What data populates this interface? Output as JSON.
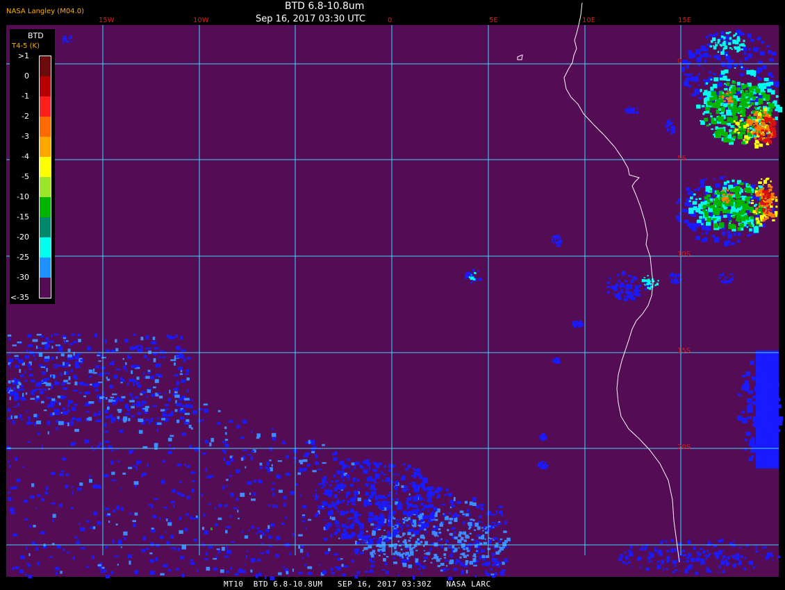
{
  "header": {
    "org_label": "NASA Langley (M04.0)",
    "title": "BTD 6.8-10.8um",
    "datetime": "Sep 16, 2017 03:30 UTC"
  },
  "footer": {
    "text": "MT10  BTD 6.8-10.8UM   SEP 16, 2017 03:30Z   NASA LARC"
  },
  "grid": {
    "longitude_labels": [
      "15W",
      "10W",
      "0",
      "5E",
      "10E",
      "15E"
    ],
    "latitude_labels": [
      "0",
      "5S",
      "10S",
      "15S",
      "20S"
    ]
  },
  "legend": {
    "title": "BTD",
    "subtitle": "T4-5 (K)",
    "ticks": [
      ">1",
      "0",
      "-1",
      "-2",
      "-3",
      "-4",
      "-5",
      "-10",
      "-15",
      "-20",
      "-25",
      "-30",
      "<-35"
    ],
    "colors": [
      "#6b0b0b",
      "#b80000",
      "#ff1e1e",
      "#ff6a00",
      "#ffa500",
      "#ffff00",
      "#9be62a",
      "#00b400",
      "#00886a",
      "#00ffee",
      "#1e90ff",
      "#1010ff",
      "#540d54"
    ]
  },
  "colors": {
    "background": "#540d54",
    "grid_line": "#40d8ff",
    "coastline": "#ffffff",
    "cloud_blue": "#1a1aff",
    "cloud_light_blue": "#3a8cff",
    "cloud_cyan": "#00ffee",
    "cloud_green": "#00b400",
    "cloud_yellow": "#ffff00",
    "cloud_orange": "#ff7a00",
    "cloud_red": "#d81010"
  }
}
